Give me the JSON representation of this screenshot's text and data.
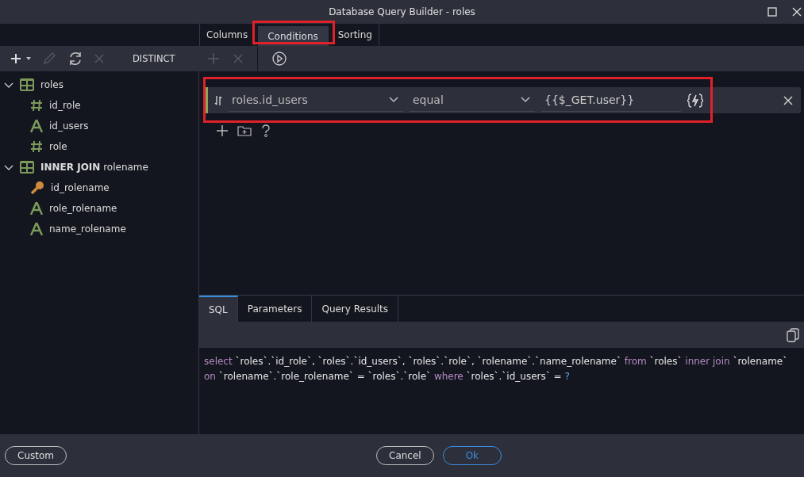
{
  "window": {
    "title": "Database Query Builder - roles"
  },
  "tabs": [
    {
      "label": "Columns",
      "selected": false
    },
    {
      "label": "Conditions",
      "selected": true
    },
    {
      "label": "Sorting",
      "selected": false
    }
  ],
  "toolbar": {
    "distinct_label": "DISTINCT"
  },
  "tables": [
    {
      "name": "roles",
      "expanded": true,
      "columns": [
        {
          "kind": "number",
          "name": "id_role"
        },
        {
          "kind": "text",
          "name": "id_users"
        },
        {
          "kind": "number",
          "name": "role"
        }
      ]
    },
    {
      "prefix": "INNER JOIN",
      "name": "rolename",
      "expanded": true,
      "columns": [
        {
          "kind": "key",
          "name": "id_rolename"
        },
        {
          "kind": "text",
          "name": "role_rolename"
        },
        {
          "kind": "text",
          "name": "name_rolename"
        }
      ]
    }
  ],
  "condition": {
    "field": "roles.id_users",
    "operator": "equal",
    "value": "{{$_GET.user}}"
  },
  "bottom_tabs": [
    {
      "label": "SQL",
      "selected": true
    },
    {
      "label": "Parameters",
      "selected": false
    },
    {
      "label": "Query Results",
      "selected": false
    }
  ],
  "sql": [
    {
      "kind": "keyword",
      "text": "select"
    },
    {
      "kind": "ident",
      "text": "`roles`.`id_role`, `roles`.`id_users`, `roles`.`role`, `rolename`.`name_rolename`"
    },
    {
      "kind": "keyword",
      "text": "from"
    },
    {
      "kind": "ident",
      "text": "`roles`"
    },
    {
      "kind": "keyword",
      "text": "inner join"
    },
    {
      "kind": "ident",
      "text": "`rolename`"
    },
    {
      "kind": "keyword",
      "text": "on"
    },
    {
      "kind": "ident",
      "text": "`rolename`.`role_rolename` = `roles`.`role`"
    },
    {
      "kind": "keyword",
      "text": "where"
    },
    {
      "kind": "ident",
      "text": "`roles`.`id_users` ="
    },
    {
      "kind": "param",
      "text": "?"
    }
  ],
  "buttons": {
    "custom": "Custom",
    "cancel": "Cancel",
    "ok": "Ok"
  }
}
